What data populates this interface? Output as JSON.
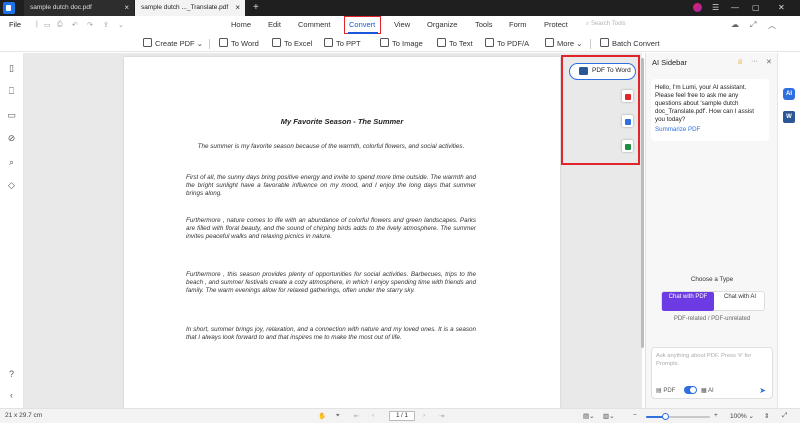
{
  "titlebar": {
    "tabs": [
      {
        "label": "sample dutch doc.pdf"
      },
      {
        "label": "sample dutch ..._Translate.pdf"
      }
    ],
    "add_tab": "+",
    "close": "×",
    "minimize": "—",
    "maximize": "▢",
    "window_close": "✕"
  },
  "menu": {
    "file": "File",
    "items": [
      "Home",
      "Edit",
      "Comment",
      "Convert",
      "View",
      "Organize",
      "Tools",
      "Form",
      "Protect"
    ],
    "active": "Convert",
    "search_placeholder": "Search Tools"
  },
  "ribbon": {
    "create_pdf": "Create PDF",
    "to_word": "To Word",
    "to_excel": "To Excel",
    "to_ppt": "To PPT",
    "to_image": "To Image",
    "to_text": "To Text",
    "to_pdfa": "To PDF/A",
    "more": "More",
    "batch_convert": "Batch Convert"
  },
  "document": {
    "title": "My Favorite Season - The Summer",
    "paragraphs": [
      "The summer is my favorite season because of the warmth, colorful flowers, and social activities.",
      "First of all, the sunny days bring positive energy and invite to spend more time outside. The warmth and the bright sunlight have a favorable influence on my mood, and I enjoy the long days that summer brings along.",
      "Furthermore , nature comes to life with an abundance of colorful flowers and green landscapes. Parks are filled with floral beauty, and the sound of chirping birds adds to the lively atmosphere. The summer invites peaceful walks and relaxing picnics in nature.",
      "Furthermore , this season provides plenty of opportunities for social activities. Barbecues, trips to the beach , and summer festivals create a cozy atmosphere, in which I enjoy spending time with friends and family. The warm evenings allow for relaxed gatherings, often under the starry sky.",
      "In short, summer brings joy, relaxation, and a connection with nature and my loved ones. It is a season that I always look forward to and that inspires me to make the most out of life."
    ],
    "pdf_to_word_button": "PDF To Word"
  },
  "ai_sidebar": {
    "title": "AI Sidebar",
    "greeting": "Hello, I'm Lumi, your AI assistant. Please feel free to ask me any questions about 'sample dutch doc_Translate.pdf'. How can I assist you today?",
    "summarize_link": "Summarize PDF",
    "choose_type": "Choose a Type",
    "chat_with_pdf": "Chat with PDF",
    "chat_with_ai": "Chat with AI",
    "type_subtitle": "PDF-related / PDF-unrelated",
    "input_placeholder": "Ask anything about PDF. Press '#' for Prompts.",
    "opt_pdf": "PDF",
    "opt_ai": "AI"
  },
  "right_rail": {
    "ai_badge": "AI",
    "word_badge": "W"
  },
  "statusbar": {
    "page_size": "21 x 29.7 cm",
    "page_current": "1 / 1",
    "zoom": "100%",
    "zoom_level": 0.3
  }
}
